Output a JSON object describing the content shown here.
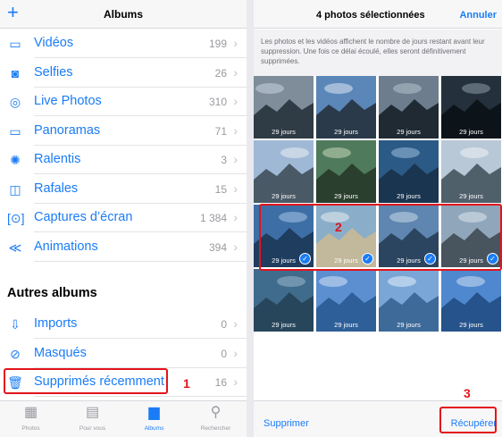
{
  "left": {
    "header": {
      "add_icon": "+",
      "title": "Albums"
    },
    "rows": [
      {
        "icon": "video-icon",
        "glyph": "▭",
        "label": "Vidéos",
        "count": "199"
      },
      {
        "icon": "selfie-icon",
        "glyph": "◙",
        "label": "Selfies",
        "count": "26"
      },
      {
        "icon": "live-photo-icon",
        "glyph": "◎",
        "label": "Live Photos",
        "count": "310"
      },
      {
        "icon": "panorama-icon",
        "glyph": "▭",
        "label": "Panoramas",
        "count": "71"
      },
      {
        "icon": "slow-motion-icon",
        "glyph": "✺",
        "label": "Ralentis",
        "count": "3"
      },
      {
        "icon": "burst-icon",
        "glyph": "◫",
        "label": "Rafales",
        "count": "15"
      },
      {
        "icon": "screenshot-icon",
        "glyph": "[⊙]",
        "label": "Captures d’écran",
        "count": "1 384"
      },
      {
        "icon": "animation-icon",
        "glyph": "≪",
        "label": "Animations",
        "count": "394"
      }
    ],
    "section_title": "Autres albums",
    "other_rows": [
      {
        "icon": "import-icon",
        "glyph": "⇩",
        "label": "Imports",
        "count": "0"
      },
      {
        "icon": "hidden-icon",
        "glyph": "⊘",
        "label": "Masqués",
        "count": "0"
      },
      {
        "icon": "trash-icon",
        "glyph": "🗑",
        "label": "Supprimés récemment",
        "count": "16"
      }
    ],
    "step1": "1",
    "tabs": [
      {
        "icon": "photos-tab-icon",
        "glyph": "▦",
        "label": "Photos",
        "active": false
      },
      {
        "icon": "for-you-tab-icon",
        "glyph": "▤",
        "label": "Pour vous",
        "active": false
      },
      {
        "icon": "albums-tab-icon",
        "glyph": "▆",
        "label": "Albums",
        "active": true
      },
      {
        "icon": "search-tab-icon",
        "glyph": "⚲",
        "label": "Rechercher",
        "active": false
      }
    ]
  },
  "right": {
    "header": {
      "title": "4 photos sélectionnées",
      "cancel": "Annuler"
    },
    "info": "Les photos et les vidéos affichent le nombre de jours restant avant leur suppression. Une fois ce délai écoulé, elles seront définitivement supprimées.",
    "photos": [
      {
        "days": "29 jours",
        "selected": false
      },
      {
        "days": "29 jours",
        "selected": false
      },
      {
        "days": "29 jours",
        "selected": false
      },
      {
        "days": "29 jours",
        "selected": false
      },
      {
        "days": "29 jours",
        "selected": false
      },
      {
        "days": "29 jours",
        "selected": false
      },
      {
        "days": "29 jours",
        "selected": false
      },
      {
        "days": "29 jours",
        "selected": false
      },
      {
        "days": "29 jours",
        "selected": true
      },
      {
        "days": "29 jours",
        "selected": true
      },
      {
        "days": "29 jours",
        "selected": true
      },
      {
        "days": "29 jours",
        "selected": true
      },
      {
        "days": "29 jours",
        "selected": false
      },
      {
        "days": "29 jours",
        "selected": false
      },
      {
        "days": "29 jours",
        "selected": false
      },
      {
        "days": "29 jours",
        "selected": false
      }
    ],
    "step2": "2",
    "step3": "3",
    "footer": {
      "delete": "Supprimer",
      "recover": "Récupérer"
    },
    "colors": {
      "accent": "#1a7cf5",
      "highlight": "#e3131b"
    }
  }
}
